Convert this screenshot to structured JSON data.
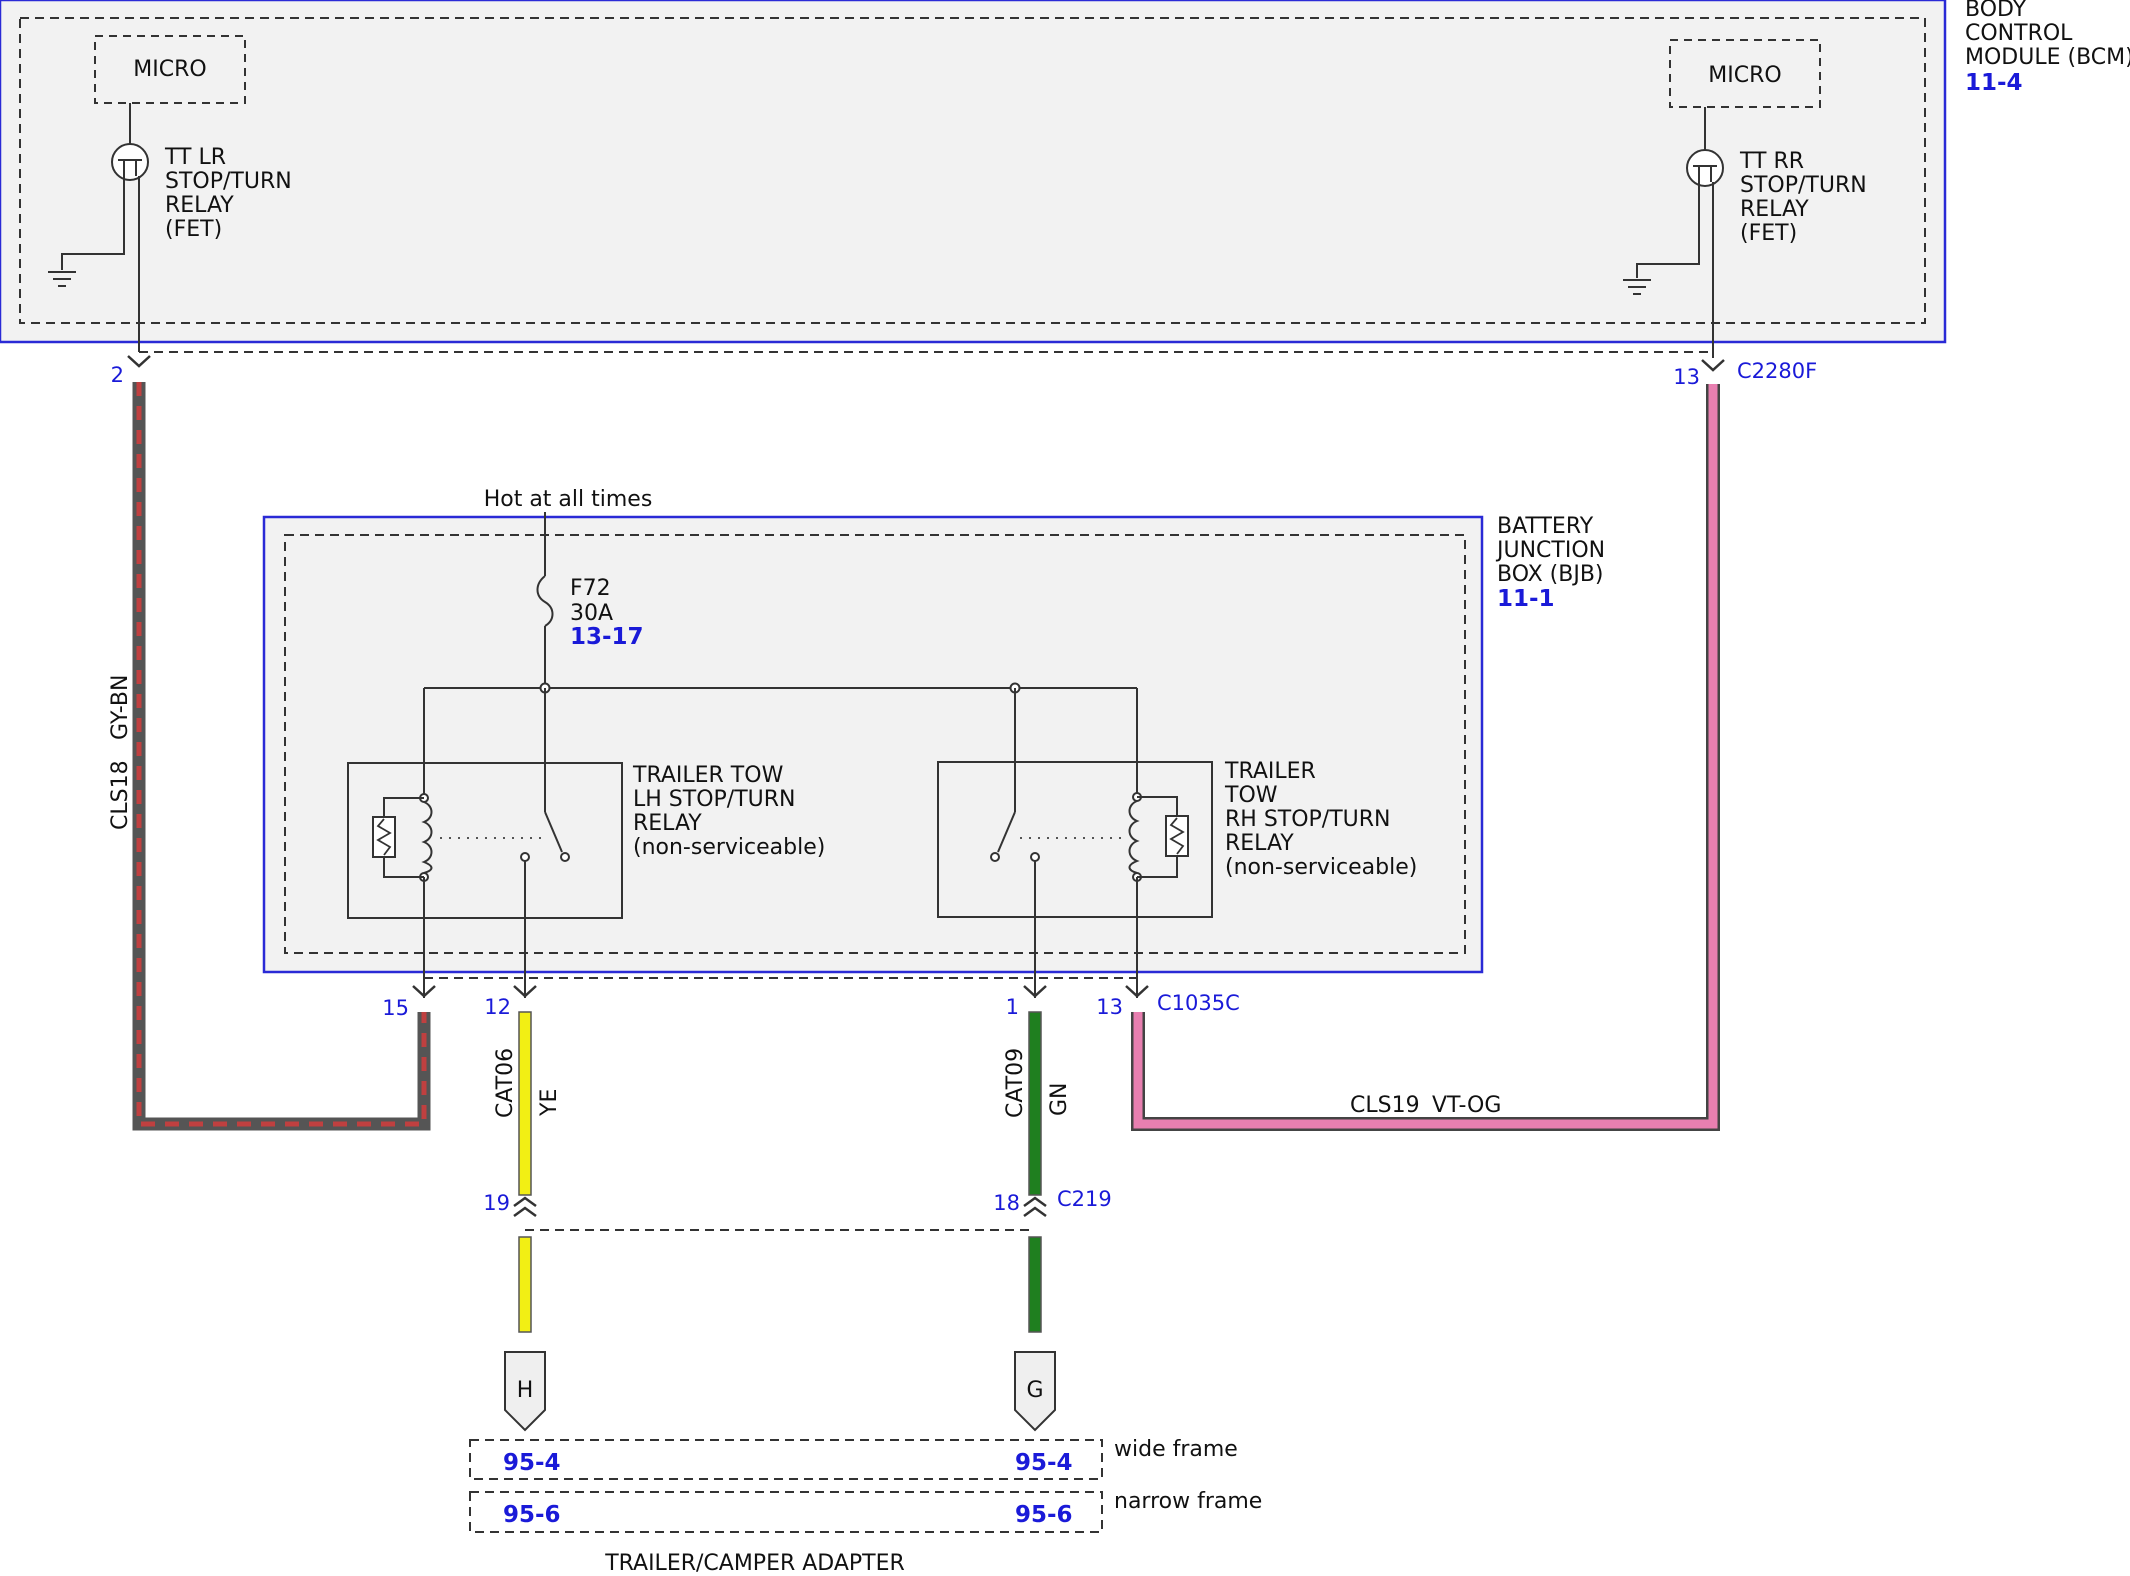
{
  "bcm": {
    "name_lines": [
      "BODY",
      "CONTROL",
      "MODULE (BCM)"
    ],
    "ref": "11-4",
    "micro_left": "MICRO",
    "micro_right": "MICRO",
    "relay_left_lines": [
      "TT LR",
      "STOP/TURN",
      "RELAY",
      "(FET)"
    ],
    "relay_right_lines": [
      "TT RR",
      "STOP/TURN",
      "RELAY",
      "(FET)"
    ],
    "connector": "C2280F",
    "pin_left": "2",
    "pin_right": "13"
  },
  "bjb": {
    "name_lines": [
      "BATTERY",
      "JUNCTION",
      "BOX (BJB)"
    ],
    "ref": "11-1",
    "hot_label": "Hot at all times",
    "fuse_name": "F72",
    "fuse_rating": "30A",
    "fuse_ref": "13-17",
    "lh_relay_lines": [
      "TRAILER TOW",
      "LH STOP/TURN",
      "RELAY",
      "(non-serviceable)"
    ],
    "rh_relay_lines": [
      "TRAILER",
      "TOW",
      "RH STOP/TURN",
      "RELAY",
      "(non-serviceable)"
    ],
    "connector": "C1035C",
    "pins": [
      "15",
      "12",
      "1",
      "13"
    ]
  },
  "wires": {
    "cls18": {
      "circuit": "CLS18",
      "color_code": "GY-BN",
      "stripe_a": "#7a7a7a",
      "stripe_b": "#c04040"
    },
    "cls19": {
      "circuit": "CLS19",
      "color_code": "VT-OG",
      "fill": "#e87fb0"
    },
    "cat06": {
      "circuit": "CAT06",
      "color_code": "YE",
      "fill": "#f2ef14"
    },
    "cat09": {
      "circuit": "CAT09",
      "color_code": "GN",
      "fill": "#1f7f1f"
    }
  },
  "c219": {
    "connector": "C219",
    "pin_left": "19",
    "pin_right": "18"
  },
  "adapter": {
    "term_left": "H",
    "term_right": "G",
    "wide_frame_label": "wide frame",
    "narrow_frame_label": "narrow frame",
    "wide_ref_left": "95-4",
    "wide_ref_right": "95-4",
    "narrow_ref_left": "95-6",
    "narrow_ref_right": "95-6",
    "caption": "TRAILER/CAMPER ADAPTER"
  }
}
